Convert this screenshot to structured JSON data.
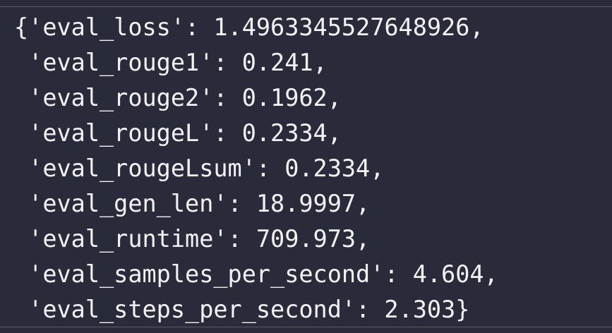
{
  "output": {
    "lines": [
      "{'eval_loss': 1.4963345527648926,",
      " 'eval_rouge1': 0.241,",
      " 'eval_rouge2': 0.1962,",
      " 'eval_rougeL': 0.2334,",
      " 'eval_rougeLsum': 0.2334,",
      " 'eval_gen_len': 18.9997,",
      " 'eval_runtime': 709.973,",
      " 'eval_samples_per_second': 4.604,",
      " 'eval_steps_per_second': 2.303}"
    ]
  },
  "colors": {
    "background": "#292b3a",
    "text": "#f2f2f4",
    "divider": "#5a5c6a"
  }
}
